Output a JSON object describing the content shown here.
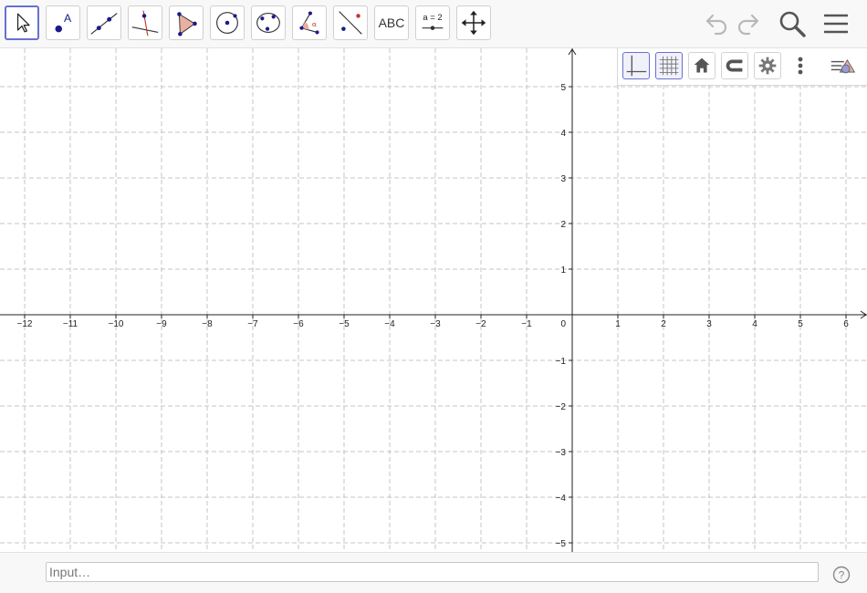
{
  "toolbar": {
    "tools": [
      {
        "id": "move",
        "label": ""
      },
      {
        "id": "point",
        "label": "A"
      },
      {
        "id": "line",
        "label": ""
      },
      {
        "id": "perpendicular",
        "label": ""
      },
      {
        "id": "polygon",
        "label": ""
      },
      {
        "id": "circle",
        "label": ""
      },
      {
        "id": "ellipse",
        "label": ""
      },
      {
        "id": "angle",
        "label": "α"
      },
      {
        "id": "reflect",
        "label": ""
      },
      {
        "id": "text",
        "label": "ABC"
      },
      {
        "id": "slider",
        "label": "a = 2"
      },
      {
        "id": "move-view",
        "label": ""
      }
    ],
    "active_tool": "move"
  },
  "graphics": {
    "x_ticks": [
      "−12",
      "−11",
      "−10",
      "−9",
      "−8",
      "−7",
      "−6",
      "−5",
      "−4",
      "−3",
      "−2",
      "−1",
      "1",
      "2",
      "3",
      "4",
      "5",
      "6"
    ],
    "y_ticks": [
      "5",
      "4",
      "3",
      "2",
      "1",
      "−1",
      "−2",
      "−3",
      "−4",
      "−5"
    ],
    "origin_label": "0",
    "axes_on": true,
    "grid_on": true
  },
  "input": {
    "placeholder": "Input…",
    "value": ""
  },
  "colors": {
    "accent": "#6a70d0",
    "point": "#1a1a8c",
    "polygon_fill": "#e8b0a0",
    "line_red": "#c0392b"
  }
}
